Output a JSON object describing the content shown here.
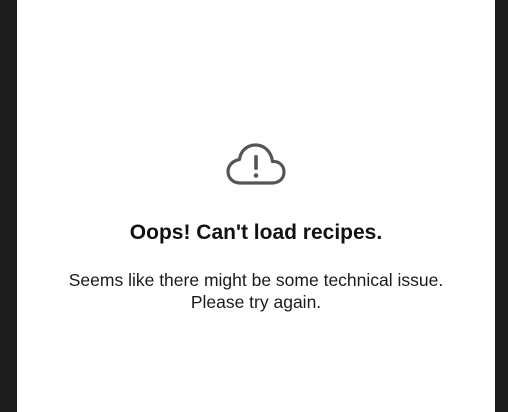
{
  "error": {
    "icon": "cloud-alert-icon",
    "title": "Oops! Can't load recipes.",
    "message_line1": "Seems like there might be some technical issue.",
    "message_line2": "Please try again."
  },
  "colors": {
    "background_outer": "#1c1c1c",
    "panel": "#ffffff",
    "icon": "#555555",
    "text": "#111111"
  }
}
